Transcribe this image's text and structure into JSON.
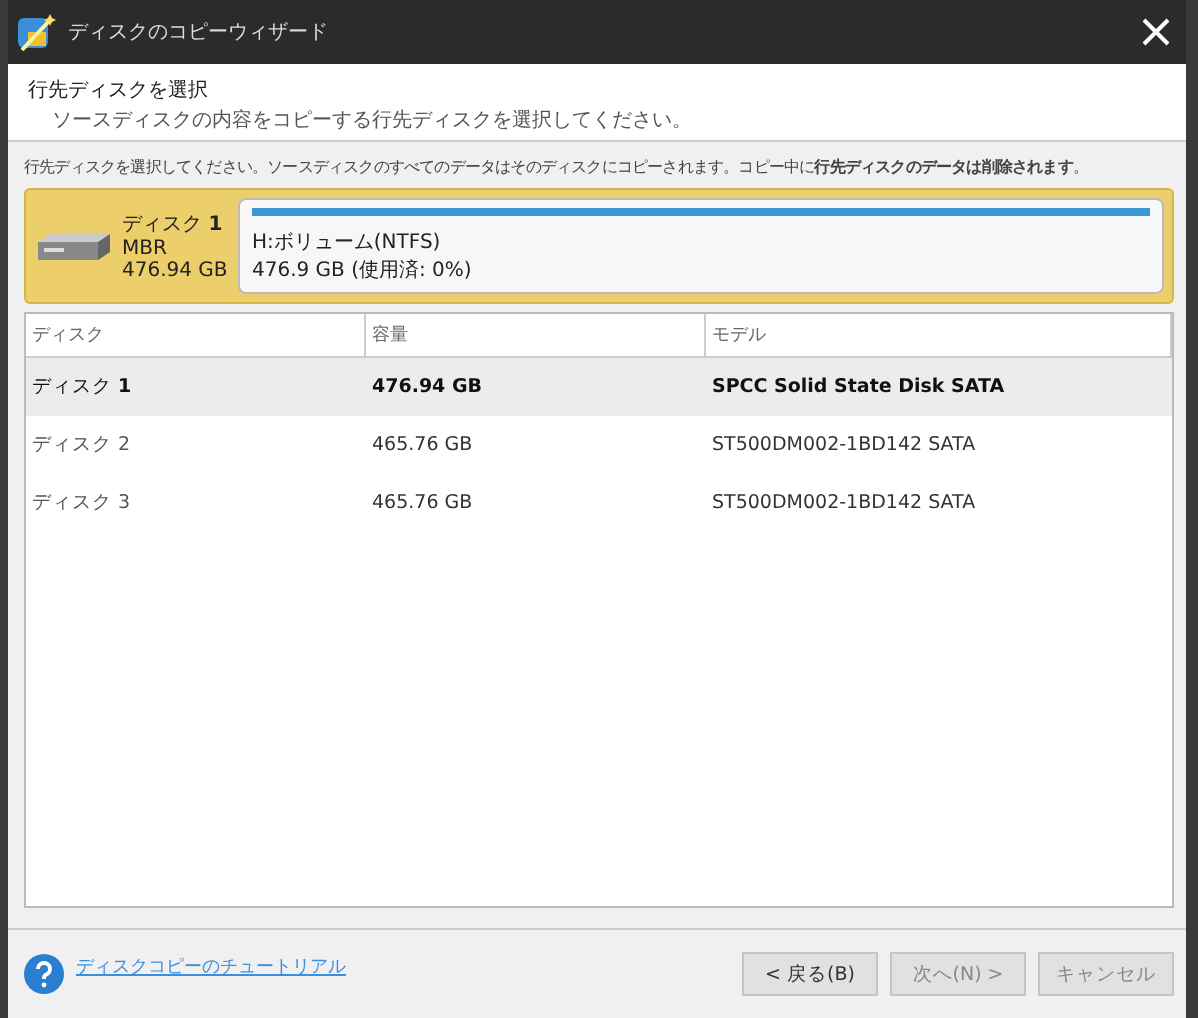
{
  "window": {
    "title": "ディスクのコピーウィザード"
  },
  "header": {
    "title": "行先ディスクを選択",
    "subtitle": "ソースディスクの内容をコピーする行先ディスクを選択してください。"
  },
  "note": "行先ディスクを選択してください。ソースディスクのすべてのデータはそのディスクにコピーされます。コピー中に**行先ディスクのデータは削除されます**。",
  "disk_card": {
    "name": "ディスク **1**",
    "type": "MBR",
    "size": "476.94 GB",
    "partition": {
      "label": "H:ボリューム(NTFS)",
      "usage": "476.9 GB (使用済: 0%)"
    }
  },
  "table": {
    "columns": [
      "ディスク",
      "容量",
      "モデル"
    ],
    "rows": [
      {
        "cells": [
          "ディスク **1**",
          "476.94 GB",
          "SPCC Solid State Disk SATA"
        ],
        "selected": true
      },
      {
        "cells": [
          "ディスク 2",
          "465.76 GB",
          "ST500DM002-1BD142 SATA"
        ],
        "selected": false
      },
      {
        "cells": [
          "ディスク 3",
          "465.76 GB",
          "ST500DM002-1BD142 SATA"
        ],
        "selected": false
      }
    ]
  },
  "footer": {
    "help_link": "ディスクコピーのチュートリアル",
    "buttons": [
      {
        "label": "< 戻る(B)",
        "disabled": false
      },
      {
        "label": "次へ(N) >",
        "disabled": true
      },
      {
        "label": "キャンセル",
        "disabled": true
      }
    ]
  }
}
